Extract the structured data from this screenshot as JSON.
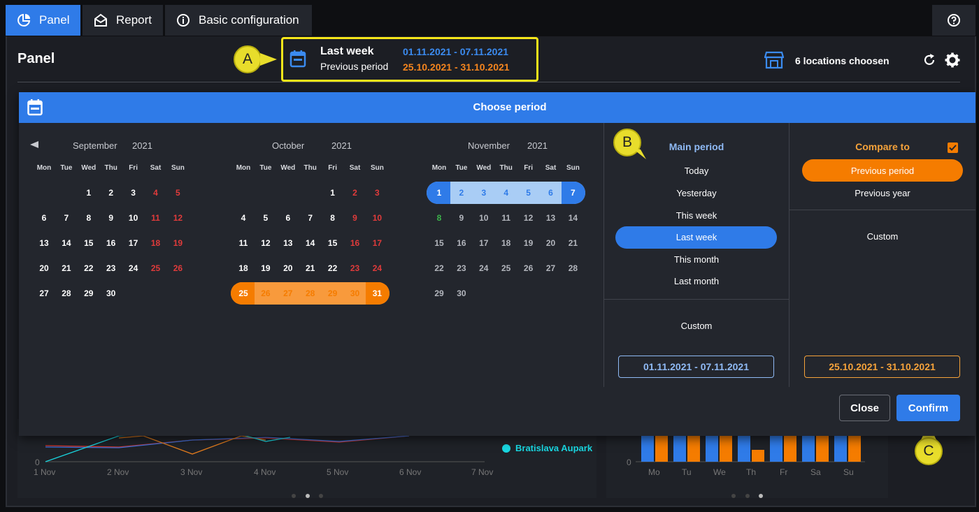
{
  "tabs": [
    {
      "label": "Panel",
      "icon": "pie-chart-icon",
      "active": true
    },
    {
      "label": "Report",
      "icon": "envelope-open-icon",
      "active": false
    },
    {
      "label": "Basic configuration",
      "icon": "info-icon",
      "active": false
    }
  ],
  "help_icon": "help-icon",
  "panel": {
    "title": "Panel"
  },
  "period_summary": {
    "main_label": "Last week",
    "main_range": "01.11.2021 - 07.11.2021",
    "compare_label": "Previous period",
    "compare_range": "25.10.2021 - 31.10.2021"
  },
  "callouts": {
    "a": "A",
    "b": "B",
    "c": "C"
  },
  "locations": {
    "text": "6 locations choosen"
  },
  "background_chart": {
    "x_ticks": [
      "1 Nov",
      "2 Nov",
      "3 Nov",
      "4 Nov",
      "5 Nov",
      "6 Nov",
      "7 Nov"
    ],
    "y_zero": "0",
    "legend": [
      {
        "label": "Bratislava Aupark",
        "color": "#19d6e0"
      }
    ],
    "bar_ticks": [
      "Mo",
      "Tu",
      "We",
      "Th",
      "Fr",
      "Sa",
      "Su"
    ]
  },
  "modal": {
    "title": "Choose period",
    "weekdays": [
      "Mon",
      "Tue",
      "Wed",
      "Thu",
      "Fri",
      "Sat",
      "Sun"
    ],
    "months": [
      {
        "name": "September",
        "year": "2021"
      },
      {
        "name": "October",
        "year": "2021"
      },
      {
        "name": "November",
        "year": "2021"
      }
    ],
    "main_period": {
      "heading": "Main period",
      "options": [
        "Today",
        "Yesterday",
        "This week",
        "Last week",
        "This month",
        "Last month"
      ],
      "selected": "Last week",
      "custom_label": "Custom",
      "range": "01.11.2021 - 07.11.2021"
    },
    "compare": {
      "heading": "Compare to",
      "checked": true,
      "options": [
        "Previous period",
        "Previous year"
      ],
      "selected": "Previous period",
      "custom_label": "Custom",
      "range": "25.10.2021 - 31.10.2021"
    },
    "close_label": "Close",
    "confirm_label": "Confirm"
  },
  "colors": {
    "accent": "#2f7be8",
    "orange": "#f57c00",
    "callout": "#e8dd2b"
  }
}
